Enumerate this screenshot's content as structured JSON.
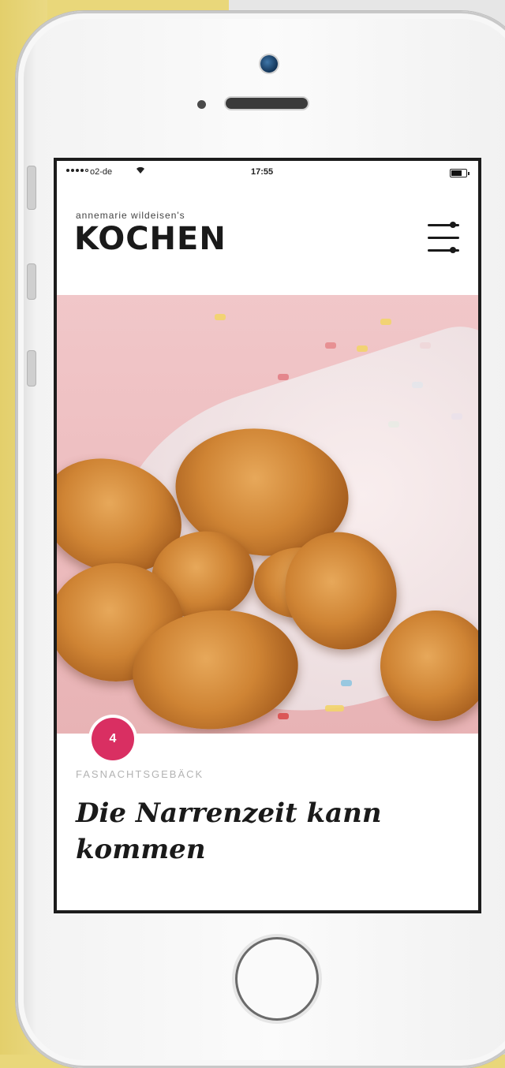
{
  "status_bar": {
    "carrier": "o2-de",
    "time": "17:55"
  },
  "header": {
    "brand_small": "annemarie wildeisen's",
    "brand_big": "KOCHEN"
  },
  "article": {
    "number": "4",
    "category": "FASNACHTSGEBÄCK",
    "title": "Die Narrenzeit kann kommen"
  },
  "colors": {
    "badge": "#d92f62",
    "background": "#e9d77a",
    "hero_pink": "#f1c7c9"
  },
  "icons": {
    "menu": "settings-sliders-icon",
    "wifi": "wifi-icon",
    "battery": "battery-icon"
  }
}
